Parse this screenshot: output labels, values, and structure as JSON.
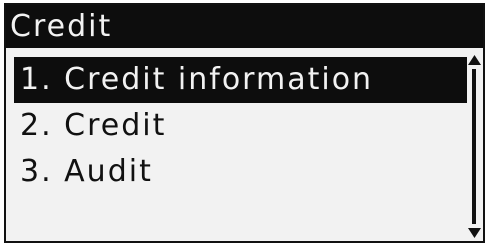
{
  "header": {
    "title": "Credit"
  },
  "menu": {
    "selected_index": 0,
    "items": [
      {
        "label": "1. Credit information"
      },
      {
        "label": "2. Credit"
      },
      {
        "label": "3. Audit"
      }
    ]
  },
  "scrollbar": {
    "up_icon": "arrow-up-icon",
    "down_icon": "arrow-down-icon"
  },
  "colors": {
    "background": "#f2f2f2",
    "foreground": "#0d0d0d"
  }
}
